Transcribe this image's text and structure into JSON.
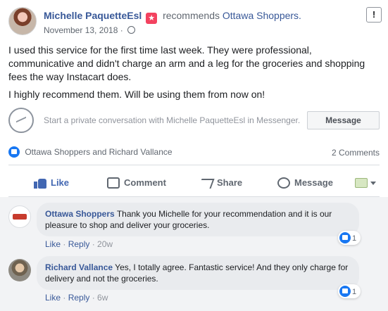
{
  "post": {
    "author": "Michelle PaquetteEsl",
    "recommends_label": "recommends",
    "page_name": "Ottawa Shoppers.",
    "date": "November 13, 2018",
    "meta_separator": "·",
    "report_label": "!",
    "paragraphs": [
      "I used this service for the first time last week. They were professional, communicative and didn't charge an arm and a leg for the groceries and shopping fees the way Instacart does.",
      "I highly recommend them. Will be using them from now on!"
    ]
  },
  "messenger": {
    "prompt": "Start a private conversation with Michelle PaquetteEsl in Messenger.",
    "button_label": "Message"
  },
  "reactions": {
    "reactors": "Ottawa Shoppers and Richard Vallance",
    "comments_count": "2 Comments"
  },
  "actions": {
    "like": "Like",
    "comment": "Comment",
    "share": "Share",
    "message": "Message"
  },
  "comments": [
    {
      "author": "Ottawa Shoppers",
      "text": "Thank you Michelle for your recommendation and it is our pleasure to shop and deliver your groceries.",
      "like_label": "Like",
      "reply_label": "Reply",
      "time": "20w",
      "reaction_count": "1"
    },
    {
      "author": "Richard Vallance",
      "text": "Yes, I totally agree. Fantastic service! And they only charge for delivery and not the groceries.",
      "like_label": "Like",
      "reply_label": "Reply",
      "time": "6w",
      "reaction_count": "1"
    }
  ],
  "colors": {
    "link_blue": "#385898",
    "like_blue": "#1877f2",
    "badge_red": "#f3425f",
    "comment_background": "#f2f3f5"
  },
  "icons": [
    "globe-icon",
    "messenger-icon",
    "like-icon",
    "comment-icon",
    "share-icon",
    "message-icon",
    "caret-down-icon"
  ]
}
